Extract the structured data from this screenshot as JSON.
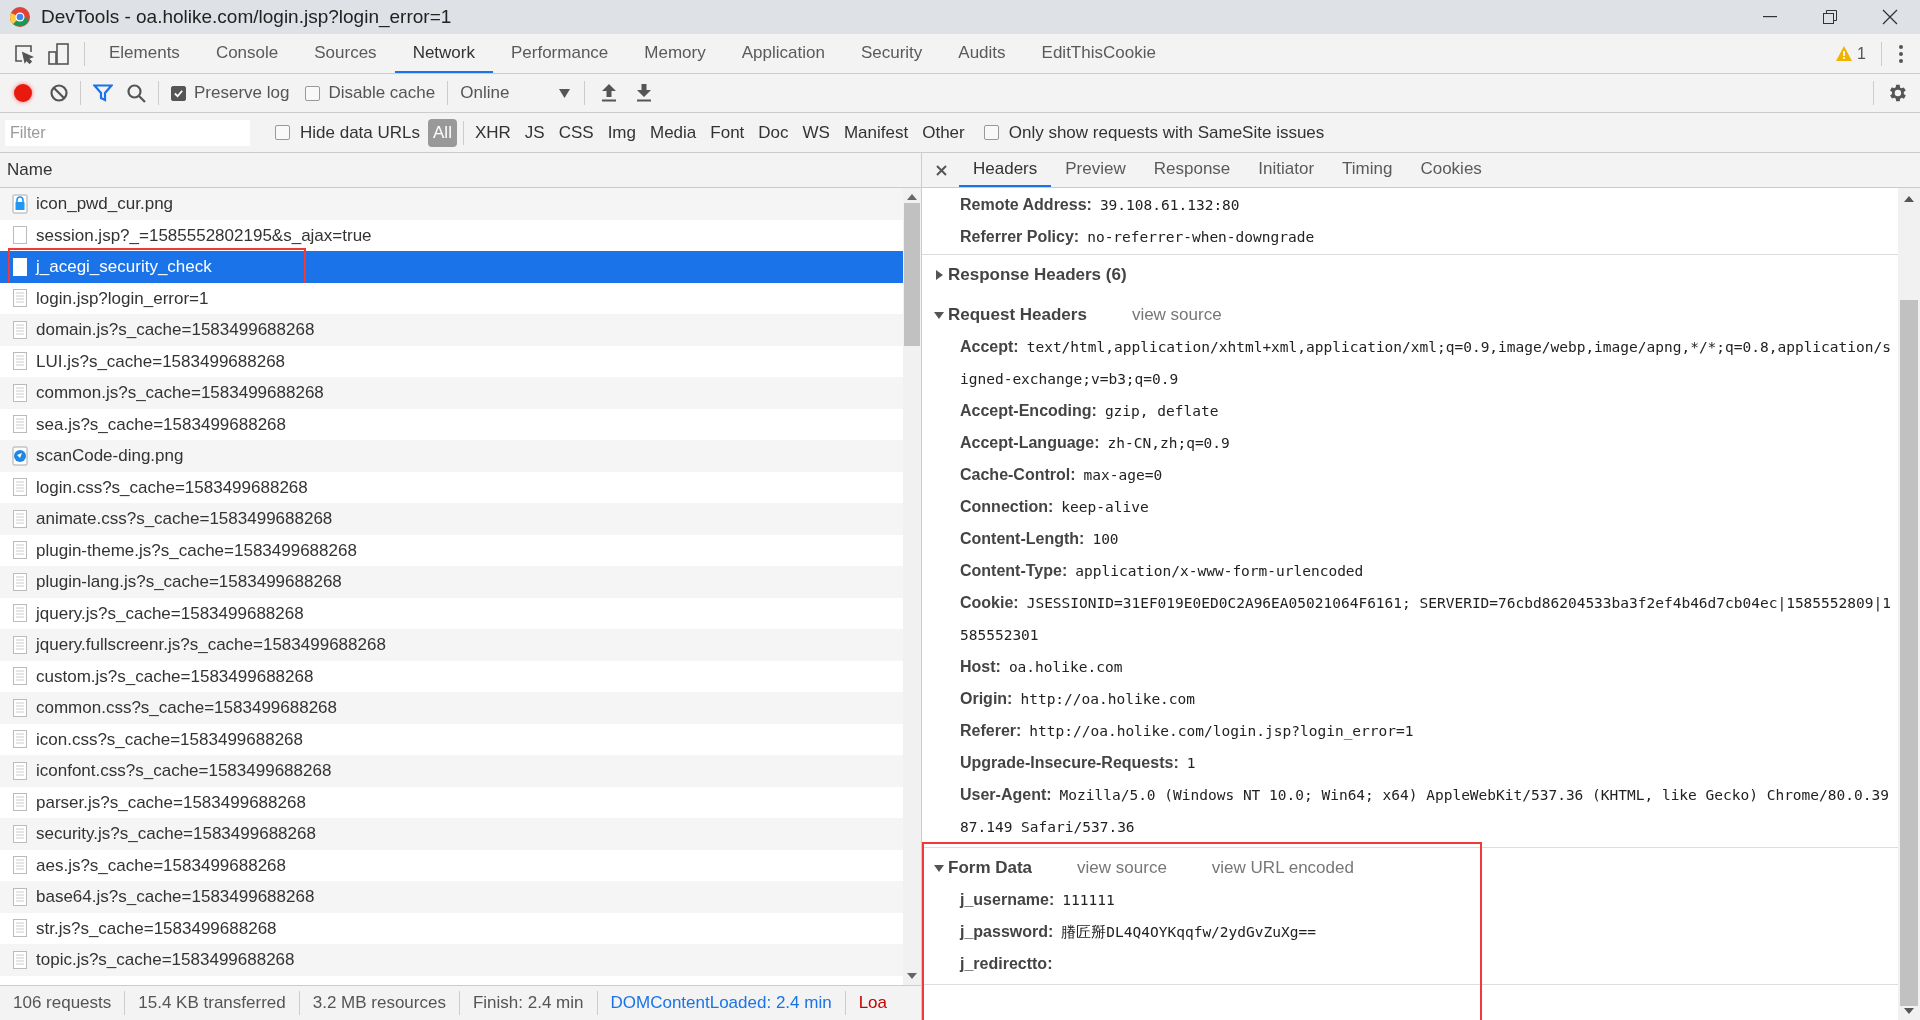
{
  "window": {
    "title": "DevTools - oa.holike.com/login.jsp?login_error=1"
  },
  "main_tabs": [
    {
      "label": "Elements",
      "selected": false
    },
    {
      "label": "Console",
      "selected": false
    },
    {
      "label": "Sources",
      "selected": false
    },
    {
      "label": "Network",
      "selected": true
    },
    {
      "label": "Performance",
      "selected": false
    },
    {
      "label": "Memory",
      "selected": false
    },
    {
      "label": "Application",
      "selected": false
    },
    {
      "label": "Security",
      "selected": false
    },
    {
      "label": "Audits",
      "selected": false
    },
    {
      "label": "EditThisCookie",
      "selected": false
    }
  ],
  "warning_count": "1",
  "toolbar": {
    "recording": true,
    "preserve_log": {
      "label": "Preserve log",
      "checked": true
    },
    "disable_cache": {
      "label": "Disable cache",
      "checked": false
    },
    "throttling": "Online"
  },
  "filter_bar": {
    "placeholder": "Filter",
    "hide_data_urls": {
      "label": "Hide data URLs",
      "checked": false
    },
    "types": [
      {
        "label": "All",
        "selected": true
      },
      {
        "label": "XHR",
        "selected": false
      },
      {
        "label": "JS",
        "selected": false
      },
      {
        "label": "CSS",
        "selected": false
      },
      {
        "label": "Img",
        "selected": false
      },
      {
        "label": "Media",
        "selected": false
      },
      {
        "label": "Font",
        "selected": false
      },
      {
        "label": "Doc",
        "selected": false
      },
      {
        "label": "WS",
        "selected": false
      },
      {
        "label": "Manifest",
        "selected": false
      },
      {
        "label": "Other",
        "selected": false
      }
    ],
    "samesite": {
      "label": "Only show requests with SameSite issues",
      "checked": false
    }
  },
  "requests": {
    "column": "Name",
    "rows": [
      {
        "name": "icon_pwd_cur.png",
        "kind": "lock",
        "selected": false,
        "highlighted": false
      },
      {
        "name": "session.jsp?_=1585552802195&s_ajax=true",
        "kind": "blank",
        "selected": false,
        "highlighted": false
      },
      {
        "name": "j_acegi_security_check",
        "kind": "blank",
        "selected": true,
        "highlighted": true
      },
      {
        "name": "login.jsp?login_error=1",
        "kind": "doc",
        "selected": false,
        "highlighted": false
      },
      {
        "name": "domain.js?s_cache=1583499688268",
        "kind": "doc",
        "selected": false,
        "highlighted": false
      },
      {
        "name": "LUI.js?s_cache=1583499688268",
        "kind": "doc",
        "selected": false,
        "highlighted": false
      },
      {
        "name": "common.js?s_cache=1583499688268",
        "kind": "doc",
        "selected": false,
        "highlighted": false
      },
      {
        "name": "sea.js?s_cache=1583499688268",
        "kind": "doc",
        "selected": false,
        "highlighted": false
      },
      {
        "name": "scanCode-ding.png",
        "kind": "scan",
        "selected": false,
        "highlighted": false
      },
      {
        "name": "login.css?s_cache=1583499688268",
        "kind": "doc",
        "selected": false,
        "highlighted": false
      },
      {
        "name": "animate.css?s_cache=1583499688268",
        "kind": "doc",
        "selected": false,
        "highlighted": false
      },
      {
        "name": "plugin-theme.js?s_cache=1583499688268",
        "kind": "doc",
        "selected": false,
        "highlighted": false
      },
      {
        "name": "plugin-lang.js?s_cache=1583499688268",
        "kind": "doc",
        "selected": false,
        "highlighted": false
      },
      {
        "name": "jquery.js?s_cache=1583499688268",
        "kind": "doc",
        "selected": false,
        "highlighted": false
      },
      {
        "name": "jquery.fullscreenr.js?s_cache=1583499688268",
        "kind": "doc",
        "selected": false,
        "highlighted": false
      },
      {
        "name": "custom.js?s_cache=1583499688268",
        "kind": "doc",
        "selected": false,
        "highlighted": false
      },
      {
        "name": "common.css?s_cache=1583499688268",
        "kind": "doc",
        "selected": false,
        "highlighted": false
      },
      {
        "name": "icon.css?s_cache=1583499688268",
        "kind": "doc",
        "selected": false,
        "highlighted": false
      },
      {
        "name": "iconfont.css?s_cache=1583499688268",
        "kind": "doc",
        "selected": false,
        "highlighted": false
      },
      {
        "name": "parser.js?s_cache=1583499688268",
        "kind": "doc",
        "selected": false,
        "highlighted": false
      },
      {
        "name": "security.js?s_cache=1583499688268",
        "kind": "doc",
        "selected": false,
        "highlighted": false
      },
      {
        "name": "aes.js?s_cache=1583499688268",
        "kind": "doc",
        "selected": false,
        "highlighted": false
      },
      {
        "name": "base64.js?s_cache=1583499688268",
        "kind": "doc",
        "selected": false,
        "highlighted": false
      },
      {
        "name": "str.js?s_cache=1583499688268",
        "kind": "doc",
        "selected": false,
        "highlighted": false
      },
      {
        "name": "topic.js?s_cache=1583499688268",
        "kind": "doc",
        "selected": false,
        "highlighted": false
      }
    ]
  },
  "status_bar": [
    {
      "text": "106 requests",
      "kind": "plain"
    },
    {
      "text": "15.4 KB transferred",
      "kind": "plain"
    },
    {
      "text": "3.2 MB resources",
      "kind": "plain"
    },
    {
      "text": "Finish: 2.4 min",
      "kind": "plain"
    },
    {
      "text": "DOMContentLoaded: 2.4 min",
      "kind": "dom"
    },
    {
      "text": "Loa",
      "kind": "load"
    }
  ],
  "detail_tabs": [
    {
      "label": "Headers",
      "selected": true
    },
    {
      "label": "Preview",
      "selected": false
    },
    {
      "label": "Response",
      "selected": false
    },
    {
      "label": "Initiator",
      "selected": false
    },
    {
      "label": "Timing",
      "selected": false
    },
    {
      "label": "Cookies",
      "selected": false
    }
  ],
  "general": [
    {
      "name": "Remote Address:",
      "value": "39.108.61.132:80"
    },
    {
      "name": "Referrer Policy:",
      "value": "no-referrer-when-downgrade"
    }
  ],
  "sections": [
    {
      "title": "Response Headers (6)",
      "expanded": false,
      "highlighted": false
    },
    {
      "title": "Request Headers",
      "expanded": true,
      "highlighted": false,
      "links": [
        "view source"
      ],
      "items": [
        {
          "name": "Accept:",
          "value": "text/html,application/xhtml+xml,application/xml;q=0.9,image/webp,image/apng,*/*;q=0.8,application/signed-exchange;v=b3;q=0.9"
        },
        {
          "name": "Accept-Encoding:",
          "value": "gzip, deflate"
        },
        {
          "name": "Accept-Language:",
          "value": "zh-CN,zh;q=0.9"
        },
        {
          "name": "Cache-Control:",
          "value": "max-age=0"
        },
        {
          "name": "Connection:",
          "value": "keep-alive"
        },
        {
          "name": "Content-Length:",
          "value": "100"
        },
        {
          "name": "Content-Type:",
          "value": "application/x-www-form-urlencoded"
        },
        {
          "name": "Cookie:",
          "value": "JSESSIONID=31EF019E0ED0C2A96EA05021064F6161; SERVERID=76cbd86204533ba3f2ef4b46d7cb04ec|1585552809|1585552301"
        },
        {
          "name": "Host:",
          "value": "oa.holike.com"
        },
        {
          "name": "Origin:",
          "value": "http://oa.holike.com"
        },
        {
          "name": "Referer:",
          "value": "http://oa.holike.com/login.jsp?login_error=1"
        },
        {
          "name": "Upgrade-Insecure-Requests:",
          "value": "1"
        },
        {
          "name": "User-Agent:",
          "value": "Mozilla/5.0 (Windows NT 10.0; Win64; x64) AppleWebKit/537.36 (KHTML, like Gecko) Chrome/80.0.3987.149 Safari/537.36"
        }
      ]
    },
    {
      "title": "Form Data",
      "expanded": true,
      "highlighted": true,
      "links": [
        "view source",
        "view URL encoded"
      ],
      "items": [
        {
          "name": "j_username:",
          "value": "111111"
        },
        {
          "name": "j_password:",
          "value": "膡匠掰DL4Q4OYKqqfw/2ydGvZuXg=="
        },
        {
          "name": "j_redirectto:"
        }
      ]
    }
  ]
}
